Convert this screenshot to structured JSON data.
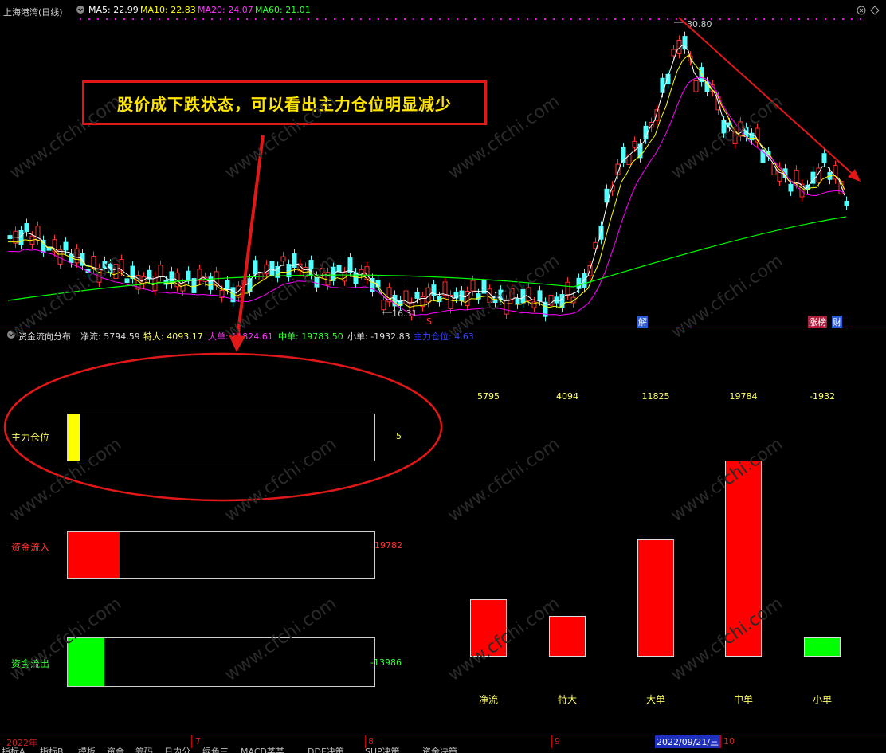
{
  "header": {
    "title": "上海港湾(日线)",
    "ma5": "MA5: 22.99",
    "ma10": "MA10: 22.83",
    "ma20": "MA20: 24.07",
    "ma60": "MA60: 21.01"
  },
  "price_chart": {
    "high_label": "30.80",
    "low_label": "16.31",
    "marker_s": "S",
    "marker_jie": "解",
    "marker_zhangting": "涨榜",
    "marker_cai": "财"
  },
  "annotation": {
    "text": "股价成下跌状态，可以看出主力仓位明显减少"
  },
  "indicator_header": {
    "title": "资金流向分布",
    "jingliu": "净流: 5794.59",
    "teda": "特大: 4093.17",
    "dadan": "大单: 11824.61",
    "zhongdan": "中单: 19783.50",
    "xiaodan": "小单: -1932.83",
    "zhulicangwei": "主力仓位: 4.63"
  },
  "left_bars": {
    "cangwei": {
      "label": "主力仓位",
      "value": "5",
      "fill_fraction": 0.04,
      "color": "#ffff00"
    },
    "inflow": {
      "label": "资金流入",
      "value": "19782",
      "fill_fraction": 0.17,
      "color": "#ff0000"
    },
    "outflow": {
      "label": "资金流出",
      "value": "-13986",
      "fill_fraction": 0.12,
      "color": "#00ff00"
    }
  },
  "column_values": [
    "5795",
    "4094",
    "11825",
    "19784",
    "-1932"
  ],
  "column_names": [
    "净流",
    "特大",
    "大单",
    "中单",
    "小单"
  ],
  "chart_data": {
    "type": "bar",
    "categories": [
      "净流",
      "特大",
      "大单",
      "中单",
      "小单"
    ],
    "values": [
      5795,
      4094,
      11825,
      19784,
      -1932
    ],
    "colors": [
      "#ff0000",
      "#ff0000",
      "#ff0000",
      "#ff0000",
      "#00ff00"
    ]
  },
  "time_axis": {
    "t1": "2022年",
    "t2": "7",
    "t3": "8",
    "t4": "9",
    "t5": "2022/09/21/三",
    "t6": "10"
  },
  "bottom_tabs": [
    "指标A",
    "指标B",
    "模板",
    "资金",
    "筹码",
    "日内分",
    "绿色三",
    "MACD某某",
    "DDE决策",
    "SUP决策",
    "资金决策"
  ],
  "colors": {
    "ma5": "#ffffff",
    "ma10": "#ffff00",
    "ma20": "#ff00ff",
    "ma60": "#00ff00",
    "up": "#ff3333",
    "down": "#54ffff"
  }
}
